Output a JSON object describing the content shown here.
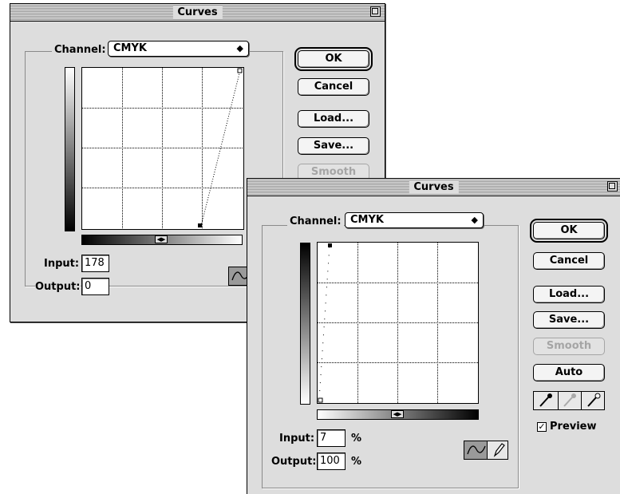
{
  "back_dialog": {
    "title": "Curves",
    "channel_label": "Channel:",
    "channel_value": "CMYK",
    "ok_label": "OK",
    "cancel_label": "Cancel",
    "load_label": "Load...",
    "save_label": "Save...",
    "smooth_label": "Smooth",
    "input_label": "Input:",
    "input_value": "178",
    "output_label": "Output:",
    "output_value": "0"
  },
  "front_dialog": {
    "title": "Curves",
    "channel_label": "Channel:",
    "channel_value": "CMYK",
    "ok_label": "OK",
    "cancel_label": "Cancel",
    "load_label": "Load...",
    "save_label": "Save...",
    "smooth_label": "Smooth",
    "auto_label": "Auto",
    "preview_label": "Preview",
    "preview_checked": true,
    "input_label": "Input:",
    "input_value": "7",
    "input_unit": "%",
    "output_label": "Output:",
    "output_value": "100",
    "output_unit": "%"
  },
  "icons": {
    "popup_arrow": "up-down-arrow-icon",
    "zoom": "zoom-box-icon",
    "curve_tool": "curve-tool-icon",
    "pencil_tool": "pencil-tool-icon",
    "eyedroppers": [
      "black-eyedropper-icon",
      "gray-eyedropper-icon",
      "white-eyedropper-icon"
    ]
  },
  "colors": {
    "window_bg": "#dddddd",
    "disabled_text": "#a5a5a5"
  }
}
